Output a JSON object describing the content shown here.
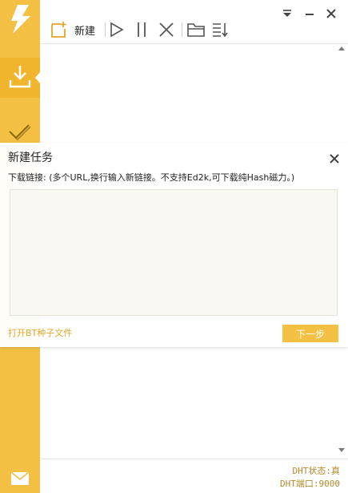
{
  "colors": {
    "accent": "#f3c043",
    "accent_dark": "#f0b52d",
    "link": "#e0a82c",
    "status_text": "#b8892a"
  },
  "sidebar": {
    "icons": [
      "lightning-logo-icon",
      "download-icon",
      "completed-check-icon",
      "mail-icon"
    ]
  },
  "toolbar": {
    "new_label": "新建",
    "icons": [
      "new-task-icon",
      "play-icon",
      "pause-icon",
      "delete-icon",
      "open-folder-icon",
      "sort-icon"
    ]
  },
  "window_controls": [
    "dropdown-menu-icon",
    "minimize-icon",
    "close-icon"
  ],
  "dialog": {
    "title": "新建任务",
    "hint": "下载链接: (多个URL,换行输入新链接。不支持Ed2k,可下载纯Hash磁力。)",
    "input_value": "",
    "open_bt_link": "打开BT种子文件",
    "next_button": "下一步"
  },
  "status": {
    "dht_state": "DHT状态:真",
    "dht_port": "DHT端口:9000"
  }
}
